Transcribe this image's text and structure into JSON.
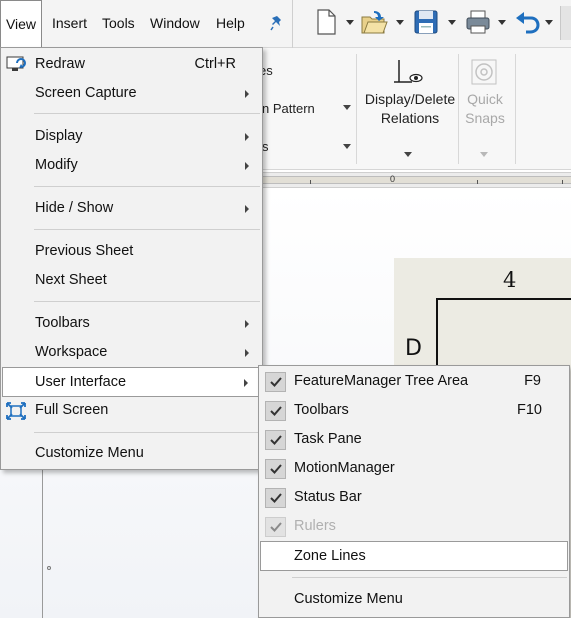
{
  "menubar": {
    "items": [
      {
        "label": "View"
      },
      {
        "label": "Insert"
      },
      {
        "label": "Tools"
      },
      {
        "label": "Window"
      },
      {
        "label": "Help"
      }
    ],
    "pin_icon": "pin-icon",
    "quick_access_icons": [
      "new-document-icon",
      "open-folder-icon",
      "save-icon",
      "print-icon",
      "undo-icon"
    ]
  },
  "ribbon": {
    "fragments": [
      "es",
      "n Pattern",
      "s"
    ],
    "display_delete": {
      "line1": "Display/Delete",
      "line2": "Relations",
      "icon": "relations-icon"
    },
    "quick_snaps": {
      "line1": "Quick",
      "line2": "Snaps",
      "icon": "quick-snaps-icon"
    }
  },
  "ruler": {
    "zero_label": "0"
  },
  "drawing": {
    "zone_column": "4",
    "zone_row": "D"
  },
  "view_menu": {
    "items": [
      {
        "label": "Redraw",
        "shortcut": "Ctrl+R",
        "icon": "redraw-icon"
      },
      {
        "label": "Screen Capture",
        "submenu": true
      },
      {
        "label": "Display",
        "submenu": true
      },
      {
        "label": "Modify",
        "submenu": true
      },
      {
        "label": "Hide / Show",
        "submenu": true
      },
      {
        "label": "Previous Sheet"
      },
      {
        "label": "Next Sheet"
      },
      {
        "label": "Toolbars",
        "submenu": true
      },
      {
        "label": "Workspace",
        "submenu": true
      },
      {
        "label": "User Interface",
        "submenu": true,
        "highlighted": true
      },
      {
        "label": "Full Screen",
        "icon": "full-screen-icon"
      },
      {
        "label": "Customize Menu"
      }
    ]
  },
  "user_interface_submenu": {
    "items": [
      {
        "label": "FeatureManager Tree Area",
        "shortcut": "F9",
        "checked": true
      },
      {
        "label": "Toolbars",
        "shortcut": "F10",
        "checked": true
      },
      {
        "label": "Task Pane",
        "checked": true
      },
      {
        "label": "MotionManager",
        "checked": true
      },
      {
        "label": "Status Bar",
        "checked": true
      },
      {
        "label": "Rulers",
        "checked": true,
        "disabled": true
      },
      {
        "label": "Zone Lines",
        "checked": false,
        "highlighted": true
      },
      {
        "label": "Customize Menu"
      }
    ]
  },
  "colors": {
    "menu_bg": "#f2f2f2",
    "highlight_bg": "#ffffff",
    "disabled_text": "#b0b0b0",
    "sheet_bg": "#ecebe3",
    "icon_blue": "#1e6fbf"
  }
}
